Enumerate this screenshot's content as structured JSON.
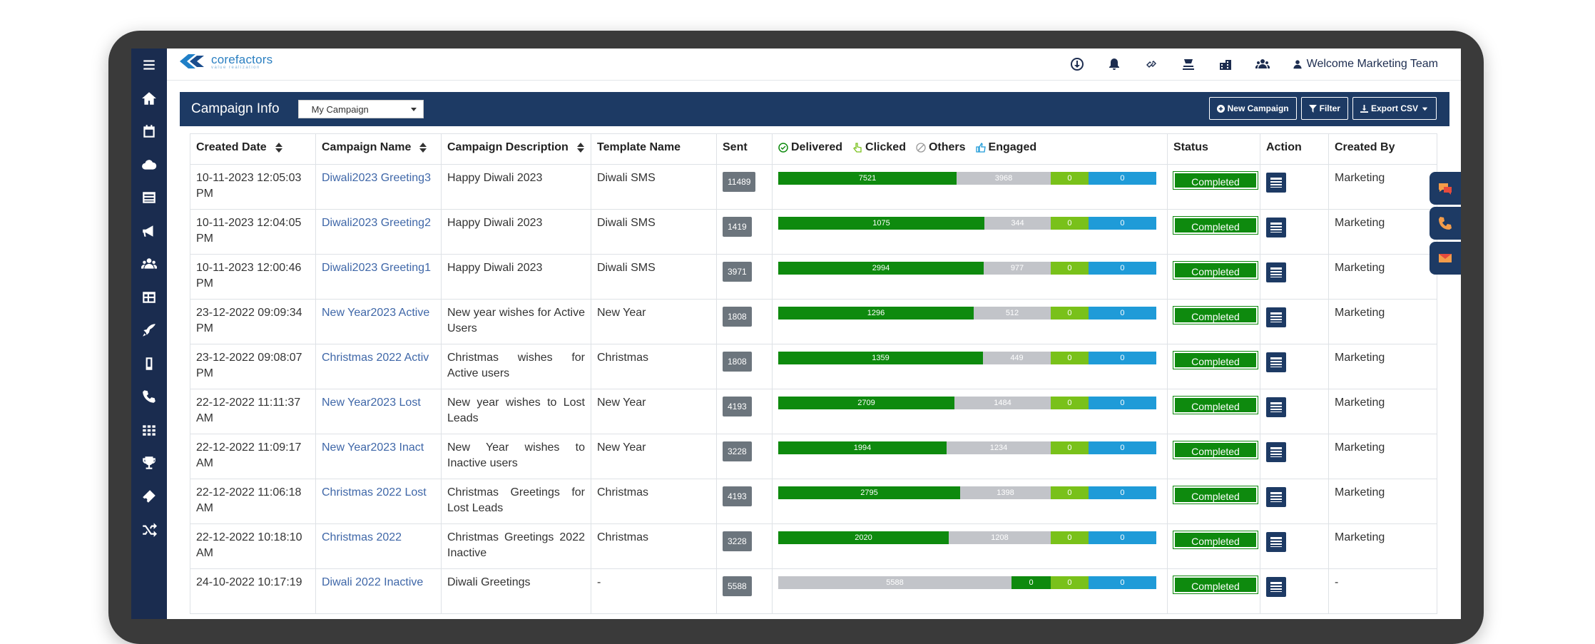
{
  "topbar": {
    "logo_text": "corefactors",
    "logo_tagline": "value realization",
    "welcome": "Welcome Marketing Team"
  },
  "panel": {
    "title": "Campaign Info",
    "campaign_select": "My Campaign",
    "new_campaign": "New Campaign",
    "filter": "Filter",
    "export": "Export CSV"
  },
  "table": {
    "headers": {
      "created_date": "Created Date",
      "campaign_name": "Campaign Name",
      "campaign_description": "Campaign Description",
      "template_name": "Template Name",
      "sent": "Sent",
      "delivered": "Delivered",
      "clicked": "Clicked",
      "others": "Others",
      "engaged": "Engaged",
      "status": "Status",
      "action": "Action",
      "created_by": "Created By"
    },
    "rows": [
      {
        "date": "10-11-2023 12:05:03 PM",
        "name": "Diwali2023 Greeting3",
        "desc": "Happy Diwali 2023",
        "template": "Diwali SMS",
        "sent": "11489",
        "delivered": "7521",
        "others": "3968",
        "clicked": "0",
        "engaged": "0",
        "status": "Completed",
        "created_by": "Marketing"
      },
      {
        "date": "10-11-2023 12:04:05 PM",
        "name": "Diwali2023 Greeting2",
        "desc": "Happy Diwali 2023",
        "template": "Diwali SMS",
        "sent": "1419",
        "delivered": "1075",
        "others": "344",
        "clicked": "0",
        "engaged": "0",
        "status": "Completed",
        "created_by": "Marketing"
      },
      {
        "date": "10-11-2023 12:00:46 PM",
        "name": "Diwali2023 Greeting1",
        "desc": "Happy Diwali 2023",
        "template": "Diwali SMS",
        "sent": "3971",
        "delivered": "2994",
        "others": "977",
        "clicked": "0",
        "engaged": "0",
        "status": "Completed",
        "created_by": "Marketing"
      },
      {
        "date": "23-12-2022 09:09:34 PM",
        "name": "New Year2023 Active",
        "desc": "New year wishes for Active Users",
        "template": "New Year",
        "sent": "1808",
        "delivered": "1296",
        "others": "512",
        "clicked": "0",
        "engaged": "0",
        "status": "Completed",
        "created_by": "Marketing"
      },
      {
        "date": "23-12-2022 09:08:07 PM",
        "name": "Christmas 2022 Activ",
        "desc": "Christmas wishes for Active users",
        "template": "Christmas",
        "sent": "1808",
        "delivered": "1359",
        "others": "449",
        "clicked": "0",
        "engaged": "0",
        "status": "Completed",
        "created_by": "Marketing"
      },
      {
        "date": "22-12-2022 11:11:37 AM",
        "name": "New Year2023 Lost",
        "desc": "New year wishes to Lost Leads",
        "template": "New Year",
        "sent": "4193",
        "delivered": "2709",
        "others": "1484",
        "clicked": "0",
        "engaged": "0",
        "status": "Completed",
        "created_by": "Marketing"
      },
      {
        "date": "22-12-2022 11:09:17 AM",
        "name": "New Year2023 Inact",
        "desc": "New Year wishes to Inactive users",
        "template": "New Year",
        "sent": "3228",
        "delivered": "1994",
        "others": "1234",
        "clicked": "0",
        "engaged": "0",
        "status": "Completed",
        "created_by": "Marketing"
      },
      {
        "date": "22-12-2022 11:06:18 AM",
        "name": "Christmas 2022 Lost",
        "desc": "Christmas Greetings for Lost Leads",
        "template": "Christmas",
        "sent": "4193",
        "delivered": "2795",
        "others": "1398",
        "clicked": "0",
        "engaged": "0",
        "status": "Completed",
        "created_by": "Marketing"
      },
      {
        "date": "22-12-2022 10:18:10 AM",
        "name": "Christmas 2022",
        "desc": "Christmas Greetings 2022 Inactive",
        "template": "Christmas",
        "sent": "3228",
        "delivered": "2020",
        "others": "1208",
        "clicked": "0",
        "engaged": "0",
        "status": "Completed",
        "created_by": "Marketing"
      },
      {
        "date": "24-10-2022 10:17:19",
        "name": "Diwali 2022 Inactive",
        "desc": "Diwali Greetings",
        "template": "-",
        "sent": "5588",
        "delivered": "0",
        "others": "5588",
        "clicked": "0",
        "engaged": "0",
        "status": "Completed",
        "created_by": "-"
      }
    ]
  },
  "colors": {
    "sidebar": "#1a2c4f",
    "panel_header": "#1d3a64",
    "delivered": "#0e8a0e",
    "others": "#c2c4c9",
    "clicked": "#79c11a",
    "engaged": "#1f9bd8"
  }
}
